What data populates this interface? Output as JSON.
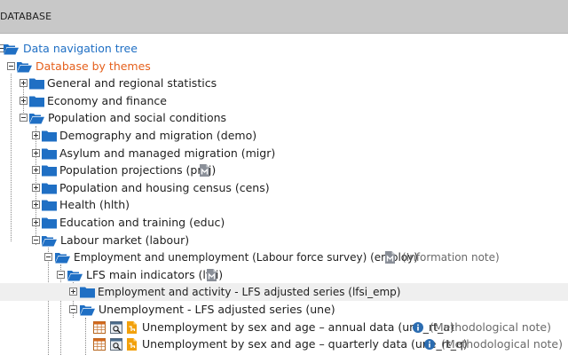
{
  "header": {
    "title": "DATABASE"
  },
  "tree": {
    "root": "Data navigation tree",
    "themes": "Database by themes",
    "general": "General and regional statistics",
    "economy": "Economy and finance",
    "population": "Population and social conditions",
    "demo": "Demography and migration (demo)",
    "migr": "Asylum and managed migration (migr)",
    "proj": "Population projections (proj)",
    "cens": "Population and housing census (cens)",
    "hlth": "Health (hlth)",
    "educ": "Education and training (educ)",
    "labour": "Labour market (labour)",
    "employ": "Employment and unemployment (Labour force survey) (employ)",
    "employ_note": "(Information note)",
    "lfsi": "LFS main indicators (lfsi)",
    "lfsi_emp": "Employment and activity - LFS adjusted series (lfsi_emp)",
    "une": "Unemployment - LFS adjusted series (une)",
    "une_rt_a": "Unemployment by sex and age – annual data (une_rt_a)",
    "une_rt_a_note": "(Methodological note)",
    "une_rt_q": "Unemployment by sex and age – quarterly data (une_rt_q)",
    "une_rt_q_note": "(Methodological note)"
  },
  "colors": {
    "folder": "#1f6fc4",
    "link": "#1f6fc4",
    "active": "#e5601c",
    "header_bg": "#c8c8c8",
    "highlight": "#efefef",
    "info": "#2b6cb0",
    "dataset_icon": "#f2a10c"
  }
}
